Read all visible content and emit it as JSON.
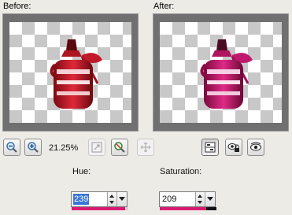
{
  "before": {
    "label": "Before:"
  },
  "after": {
    "label": "After:"
  },
  "toolbar": {
    "zoom_level": "21.25%",
    "icons": [
      "zoom-out-icon",
      "zoom-in-icon",
      "fit-window-icon",
      "actual-size-icon",
      "pan-icon",
      "split-view-icon",
      "lock-icon",
      "eye-icon"
    ]
  },
  "hue": {
    "label": "Hue:",
    "value": "239",
    "level": 0.94,
    "color": "#d81b72"
  },
  "saturation": {
    "label": "Saturation:",
    "value": "209",
    "level": 0.82,
    "color": "#d81b72"
  },
  "colors": {
    "accent": "#d81b72",
    "selection": "#3875d7"
  }
}
